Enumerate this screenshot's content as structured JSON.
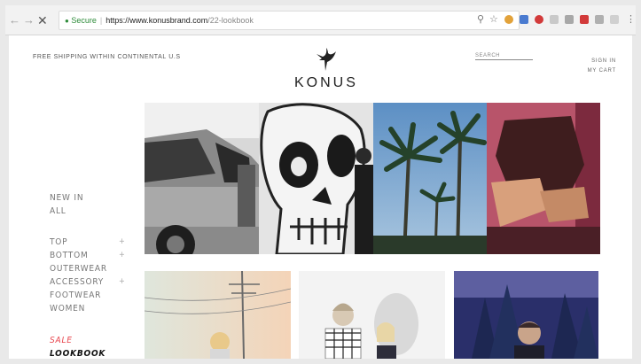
{
  "browser": {
    "secure_label": "Secure",
    "url_host": "https://www.konusbrand.com",
    "url_path": "/22-lookbook"
  },
  "header": {
    "shipping": "FREE SHIPPING WITHIN CONTINENTAL U.S",
    "brand": "KONUS",
    "search_placeholder": "SEARCH",
    "sign_in": "SIGN IN",
    "my_cart": "MY CART"
  },
  "sidebar": {
    "new_in": "NEW IN",
    "all": "ALL",
    "categories": [
      {
        "label": "TOP",
        "plus": "+"
      },
      {
        "label": "BOTTOM",
        "plus": "+"
      },
      {
        "label": "OUTERWEAR",
        "plus": ""
      },
      {
        "label": "ACCESSORY",
        "plus": "+"
      },
      {
        "label": "FOOTWEAR",
        "plus": ""
      },
      {
        "label": "WOMEN",
        "plus": ""
      }
    ],
    "sale": "SALE",
    "lookbook": "LOOKBOOK"
  },
  "colors": {
    "sale": "#e8464e"
  }
}
